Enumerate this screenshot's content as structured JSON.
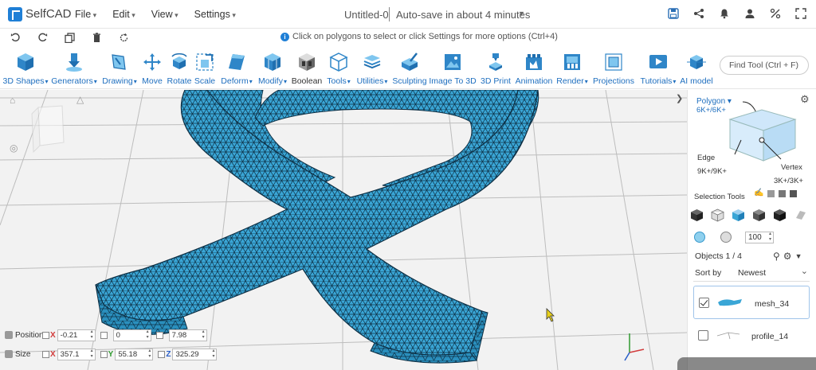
{
  "app": {
    "name": "SelfCAD"
  },
  "menu": [
    "File",
    "Edit",
    "View",
    "Settings"
  ],
  "document": {
    "title": "Untitled-0",
    "autosave": "Auto-save in about 4 minutes"
  },
  "hint": "Click on polygons to select or click Settings for more options (Ctrl+4)",
  "toolbar": [
    {
      "label": "3D Shapes",
      "dropdown": true
    },
    {
      "label": "Generators",
      "dropdown": true
    },
    {
      "label": "Drawing",
      "dropdown": true
    },
    {
      "label": "Move",
      "dropdown": false
    },
    {
      "label": "Rotate",
      "dropdown": false
    },
    {
      "label": "Scale",
      "dropdown": false
    },
    {
      "label": "Deform",
      "dropdown": true
    },
    {
      "label": "Modify",
      "dropdown": true
    },
    {
      "label": "Boolean",
      "dropdown": false
    },
    {
      "label": "Tools",
      "dropdown": true
    },
    {
      "label": "Utilities",
      "dropdown": true
    },
    {
      "label": "Sculpting",
      "dropdown": false
    },
    {
      "label": "Image To 3D",
      "dropdown": false
    },
    {
      "label": "3D Print",
      "dropdown": false
    },
    {
      "label": "Animation",
      "dropdown": false
    },
    {
      "label": "Render",
      "dropdown": true
    },
    {
      "label": "Projections",
      "dropdown": false
    },
    {
      "label": "Tutorials",
      "dropdown": true
    },
    {
      "label": "AI model",
      "dropdown": false
    }
  ],
  "find_tool": {
    "placeholder": "Find Tool (Ctrl + F)"
  },
  "transform": {
    "position_label": "Position",
    "size_label": "Size",
    "position": {
      "x": "-0.21",
      "y": "0",
      "z": "7.98"
    },
    "size": {
      "x": "357.1",
      "y": "55.18",
      "z": "325.29"
    },
    "axis_labels": {
      "x": "X",
      "y": "Y",
      "z": "Z"
    }
  },
  "selection": {
    "polygon_label": "Polygon",
    "polygon_count": "6K+/6K+",
    "edge_label": "Edge",
    "edge_count": "9K+/9K+",
    "vertex_label": "Vertex",
    "vertex_count": "3K+/3K+",
    "tools_label": "Selection Tools",
    "brush_size": "100"
  },
  "objects": {
    "count_label": "Objects 1 / 4",
    "sort_label": "Sort by",
    "sort_value": "Newest",
    "items": [
      {
        "name": "mesh_34",
        "checked": true
      },
      {
        "name": "profile_14",
        "checked": false
      }
    ]
  },
  "colors": {
    "accent": "#1f6fbf",
    "mesh": "#3aa6d6",
    "mesh_wire": "#0d2f44"
  }
}
